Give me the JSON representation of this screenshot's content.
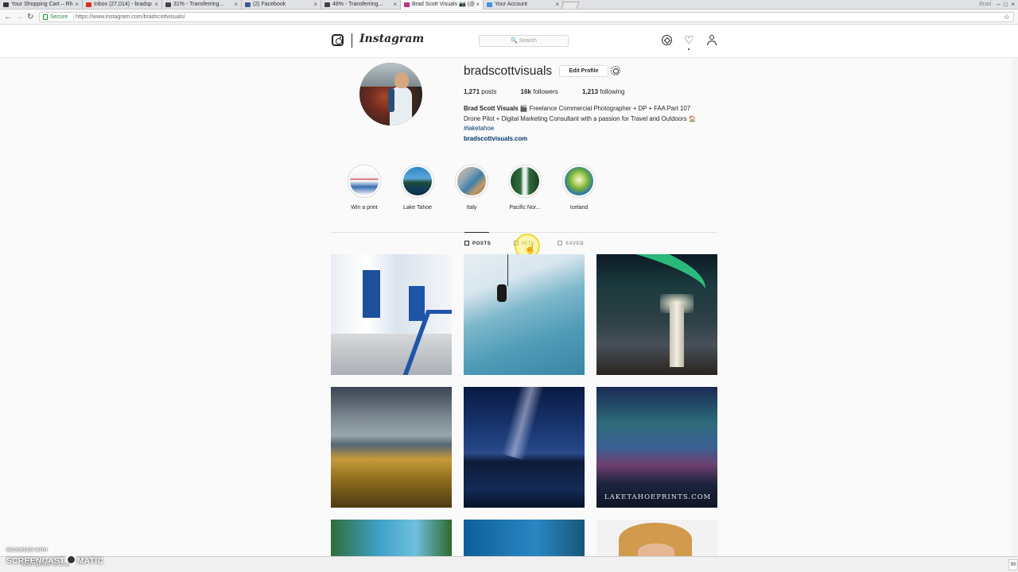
{
  "browser": {
    "tabs": [
      {
        "label": "Your Shopping Cart – Rh",
        "fav": "#333333"
      },
      {
        "label": "Inbox (27,014) - bradsp",
        "fav": "#d93025"
      },
      {
        "label": "31% - Transferring...",
        "fav": "#444444"
      },
      {
        "label": "(2) Facebook",
        "fav": "#3b5998"
      },
      {
        "label": "48% - Transferring...",
        "fav": "#444444"
      },
      {
        "label": "Brad Scott Visuals 📷 (@",
        "fav": "#c13584"
      },
      {
        "label": "Your Account",
        "fav": "#4a90d9"
      }
    ],
    "close_glyph": "×",
    "window_user": "Brad",
    "secure_label": "Secure",
    "url": "https://www.instagram.com/bradscottvisuals/"
  },
  "header": {
    "wordmark": "Instagram",
    "search_placeholder": "🔍 Search"
  },
  "profile": {
    "username": "bradscottvisuals",
    "edit_label": "Edit Profile",
    "posts_count": "1,271",
    "posts_label": "posts",
    "followers_count": "16k",
    "followers_label": "followers",
    "following_count": "1,213",
    "following_label": "following",
    "bio_name": "Brad Scott Visuals",
    "bio_line1": " 🎬 Freelance Commercial Photographer + DP + FAA Part 107",
    "bio_line2": "Drone Pilot + Digital Marketing Consultant with a passion for Travel and Outdoors 🏠",
    "bio_hashtag": "#laketahoe",
    "website": "bradscottvisuals.com"
  },
  "highlights": [
    {
      "label": "Win a print"
    },
    {
      "label": "Lake Tahoe"
    },
    {
      "label": "Italy"
    },
    {
      "label": "Pacific Nor..."
    },
    {
      "label": "Iceland"
    }
  ],
  "post_tabs": {
    "posts": "POSTS",
    "igtv": "IGTV",
    "saved": "SAVED"
  },
  "watermark": "LAKETAHOEPRINTS.COM",
  "recorder": {
    "recorded_with": "RECORDED WITH",
    "brand_left": "SCREENCAST",
    "brand_right": "MATIC",
    "sub": "Video Spooner at Loop"
  },
  "bottom_right": "Sh"
}
